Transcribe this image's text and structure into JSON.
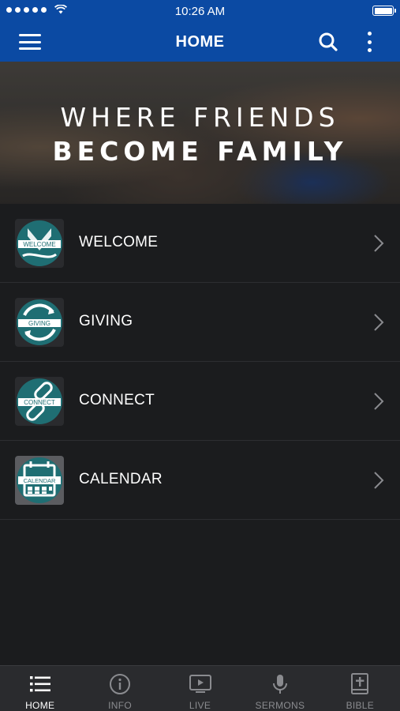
{
  "status_bar": {
    "time": "10:26 AM"
  },
  "nav": {
    "title": "HOME"
  },
  "hero": {
    "line1": "WHERE FRIENDS",
    "line2": "BECOME FAMILY"
  },
  "items": [
    {
      "label": "WELCOME",
      "icon_text": "WELCOME",
      "icon": "welcome-icon"
    },
    {
      "label": "GIVING",
      "icon_text": "GIVING",
      "icon": "giving-icon"
    },
    {
      "label": "CONNECT",
      "icon_text": "CONNECT",
      "icon": "connect-icon"
    },
    {
      "label": "CALENDAR",
      "icon_text": "CALENDAR",
      "icon": "calendar-icon"
    }
  ],
  "tabs": [
    {
      "label": "HOME",
      "icon": "list-icon",
      "active": true
    },
    {
      "label": "INFO",
      "icon": "info-icon",
      "active": false
    },
    {
      "label": "LIVE",
      "icon": "live-tv-icon",
      "active": false
    },
    {
      "label": "SERMONS",
      "icon": "microphone-icon",
      "active": false
    },
    {
      "label": "BIBLE",
      "icon": "bible-icon",
      "active": false
    }
  ],
  "colors": {
    "brand_blue": "#0b4aa3",
    "background": "#1b1c1e",
    "icon_teal": "#1f6e73",
    "tab_bar": "#2a2b2e"
  }
}
